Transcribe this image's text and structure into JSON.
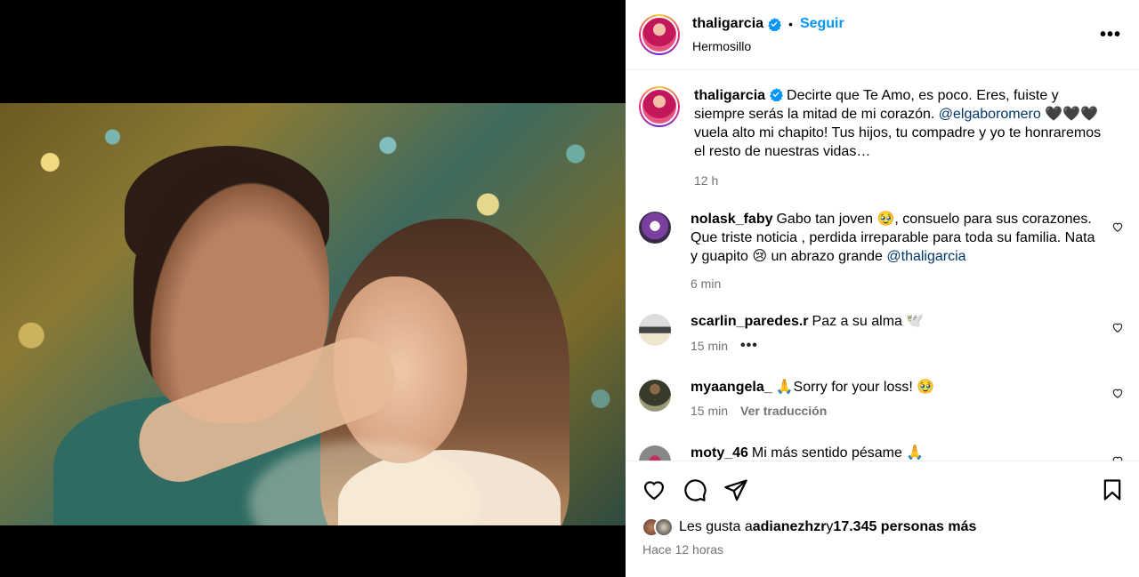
{
  "post": {
    "username": "thaligarcia",
    "follow_label": "Seguir",
    "separator": "•",
    "location": "Hermosillo",
    "more_label": "•••"
  },
  "caption": {
    "username": "thaligarcia",
    "text_before": "Decirte que Te Amo, es poco. Eres, fuiste y siempre serás la mitad de mi corazón. ",
    "mention": "@elgaboromero",
    "text_after": " 🖤🖤🖤 vuela alto mi chapito! Tus hijos, tu compadre y yo te honraremos el resto de nuestras vidas…",
    "time": "12 h"
  },
  "comments": [
    {
      "username": "nolask_faby",
      "text": "Gabo tan joven 🥹, consuelo para sus corazones. Que triste noticia , perdida irreparable para toda su familia. Nata y guapito 😢 un abrazo grande ",
      "mention": "@thaligarcia",
      "time": "6 min",
      "extra": ""
    },
    {
      "username": "scarlin_paredes.r",
      "text": "Paz a su alma 🕊️",
      "mention": "",
      "time": "15 min",
      "extra": "•••"
    },
    {
      "username": "myaangela_",
      "text": "🙏Sorry for your loss! 🥹",
      "mention": "",
      "time": "15 min",
      "extra": "Ver traducción"
    },
    {
      "username": "moty_46",
      "text": "Mi más sentido pésame 🙏",
      "mention": "",
      "time": "",
      "extra": ""
    }
  ],
  "footer": {
    "likes_prefix": "Les gusta a ",
    "likes_user": "adianezhzr",
    "likes_conj": " y ",
    "likes_count": "17.345 personas más",
    "time": "Hace 12 horas"
  },
  "icons": {
    "verified": "verified-badge-icon",
    "like": "heart-icon",
    "comment": "comment-icon",
    "share": "paper-plane-icon",
    "save": "bookmark-icon"
  },
  "colors": {
    "accent": "#0095f6",
    "mention": "#00376b",
    "muted": "#737373"
  }
}
